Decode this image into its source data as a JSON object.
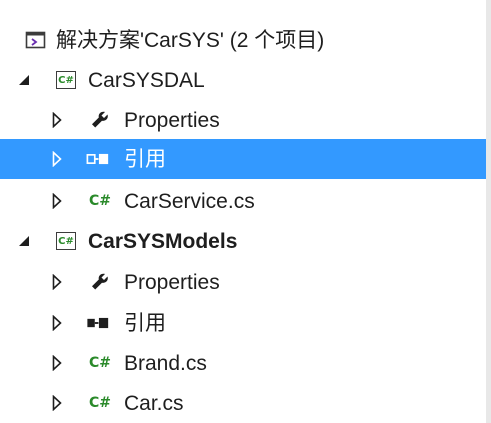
{
  "solution": {
    "label": "解决方案'CarSYS' (2 个项目)",
    "icon": "solution-icon"
  },
  "projects": [
    {
      "label": "CarSYSDAL",
      "icon": "csharp-project-icon",
      "items": [
        {
          "label": "Properties",
          "icon": "wrench-icon"
        },
        {
          "label": "引用",
          "icon": "references-icon",
          "selected": true
        },
        {
          "label": "CarService.cs",
          "icon": "csharp-file-icon"
        }
      ]
    },
    {
      "label": "CarSYSModels",
      "icon": "csharp-project-icon",
      "items": [
        {
          "label": "Properties",
          "icon": "wrench-icon"
        },
        {
          "label": "引用",
          "icon": "references-icon"
        },
        {
          "label": "Brand.cs",
          "icon": "csharp-file-icon"
        },
        {
          "label": "Car.cs",
          "icon": "csharp-file-icon"
        }
      ]
    }
  ],
  "colors": {
    "selection": "#3399ff",
    "csharp": "#2a8a2a"
  }
}
